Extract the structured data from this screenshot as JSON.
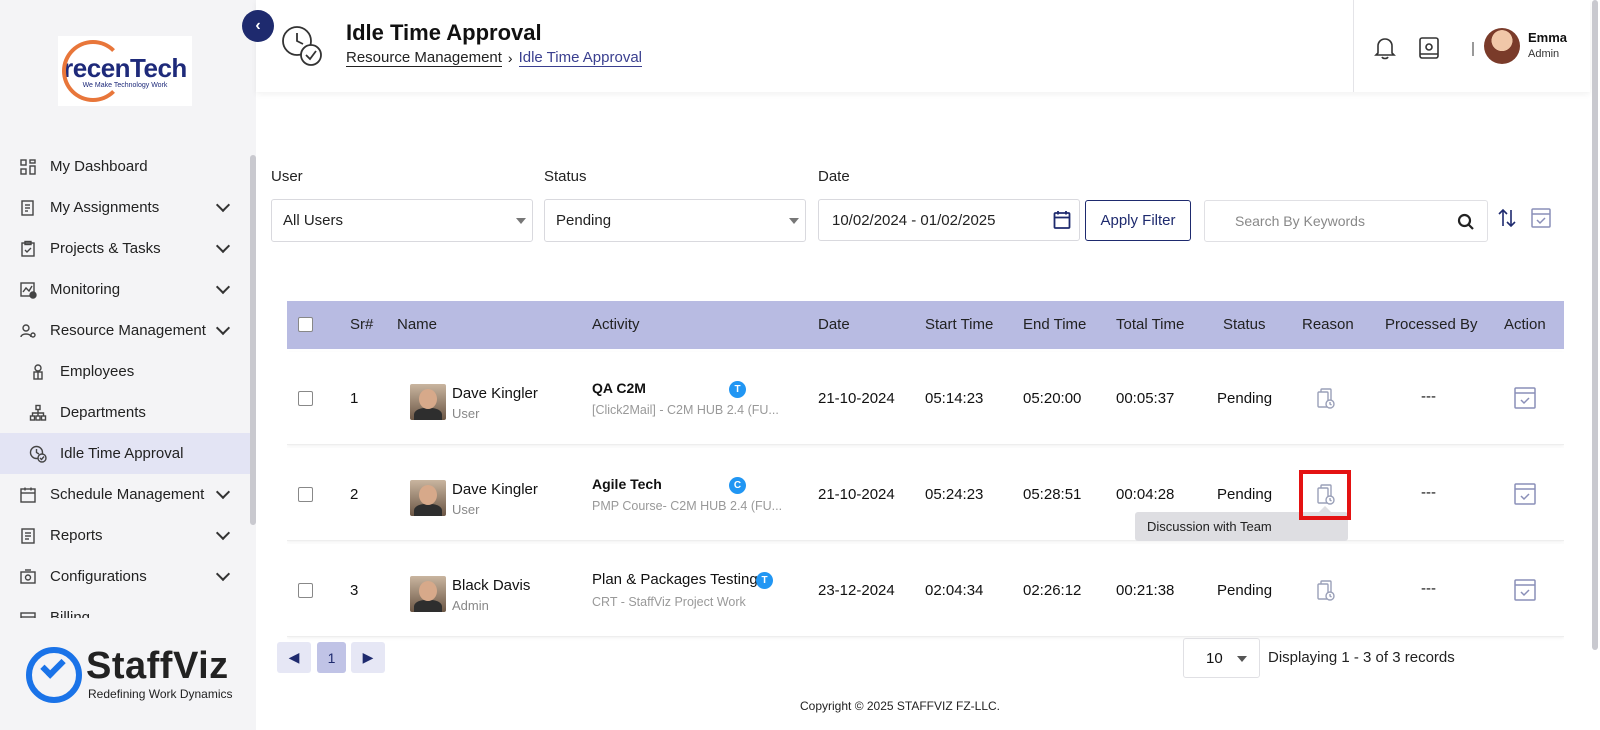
{
  "brand": {
    "top_logo_main": "recenTech",
    "top_logo_sub": "We Make Technology Work",
    "bottom_logo": "StaffViz",
    "bottom_tagline": "Redefining Work Dynamics"
  },
  "sidebar": {
    "items": [
      {
        "label": "My Dashboard",
        "icon": "dashboard-icon",
        "chevron": false
      },
      {
        "label": "My Assignments",
        "icon": "assignments-icon",
        "chevron": true
      },
      {
        "label": "Projects & Tasks",
        "icon": "clipboard-icon",
        "chevron": true
      },
      {
        "label": "Monitoring",
        "icon": "monitoring-icon",
        "chevron": true
      },
      {
        "label": "Resource Management",
        "icon": "users-gear-icon",
        "chevron": true
      },
      {
        "label": "Employees",
        "icon": "employee-icon",
        "sub": true
      },
      {
        "label": "Departments",
        "icon": "org-chart-icon",
        "sub": true
      },
      {
        "label": "Idle Time Approval",
        "icon": "clock-check-icon",
        "sub": true,
        "active": true
      },
      {
        "label": "Schedule Management",
        "icon": "calendar-icon",
        "chevron": true
      },
      {
        "label": "Reports",
        "icon": "report-icon",
        "chevron": true
      },
      {
        "label": "Configurations",
        "icon": "config-icon",
        "chevron": true
      },
      {
        "label": "Billing",
        "icon": "billing-icon",
        "chevron": false
      }
    ]
  },
  "header": {
    "title": "Idle Time Approval",
    "breadcrumb": [
      "Resource Management",
      "Idle Time Approval"
    ],
    "user_name": "Emma",
    "user_role": "Admin"
  },
  "filters": {
    "user_label": "User",
    "user_value": "All Users",
    "status_label": "Status",
    "status_value": "Pending",
    "date_label": "Date",
    "date_value": "10/02/2024 - 01/02/2025",
    "apply_label": "Apply Filter",
    "search_placeholder": "Search By Keywords"
  },
  "table": {
    "columns": [
      "Sr#",
      "Name",
      "Activity",
      "Date",
      "Start Time",
      "End Time",
      "Total Time",
      "Status",
      "Reason",
      "Processed By",
      "Action"
    ],
    "rows": [
      {
        "sr": "1",
        "name": "Dave Kingler",
        "role": "User",
        "activity": "QA C2M",
        "activity_sub": "[Click2Mail] - C2M HUB 2.4 (FU...",
        "badge": "T",
        "date": "21-10-2024",
        "start": "05:14:23",
        "end": "05:20:00",
        "total": "00:05:37",
        "status": "Pending",
        "processed_by": "---"
      },
      {
        "sr": "2",
        "name": "Dave Kingler",
        "role": "User",
        "activity": "Agile Tech",
        "activity_sub": "PMP Course- C2M HUB 2.4 (FU...",
        "badge": "C",
        "date": "21-10-2024",
        "start": "05:24:23",
        "end": "05:28:51",
        "total": "00:04:28",
        "status": "Pending",
        "processed_by": "---"
      },
      {
        "sr": "3",
        "name": "Black Davis",
        "role": "Admin",
        "activity": "Plan & Packages Testing",
        "activity_sub": "CRT - StaffViz Project Work",
        "badge": "T",
        "date": "23-12-2024",
        "start": "02:04:34",
        "end": "02:26:12",
        "total": "00:21:38",
        "status": "Pending",
        "processed_by": "---"
      }
    ],
    "tooltip": "Discussion with Team"
  },
  "pagination": {
    "prev": "◀",
    "current": "1",
    "next": "▶",
    "per_page": "10",
    "records": "Displaying 1 - 3 of 3 records"
  },
  "footer": {
    "copyright": "Copyright © 2025 STAFFVIZ FZ-LLC."
  },
  "colors": {
    "navy": "#1e2a6e",
    "table_header": "#b8bbe2",
    "active_nav": "#e3e4f4",
    "badge_blue": "#2196f3",
    "highlight_red": "#e41212"
  }
}
